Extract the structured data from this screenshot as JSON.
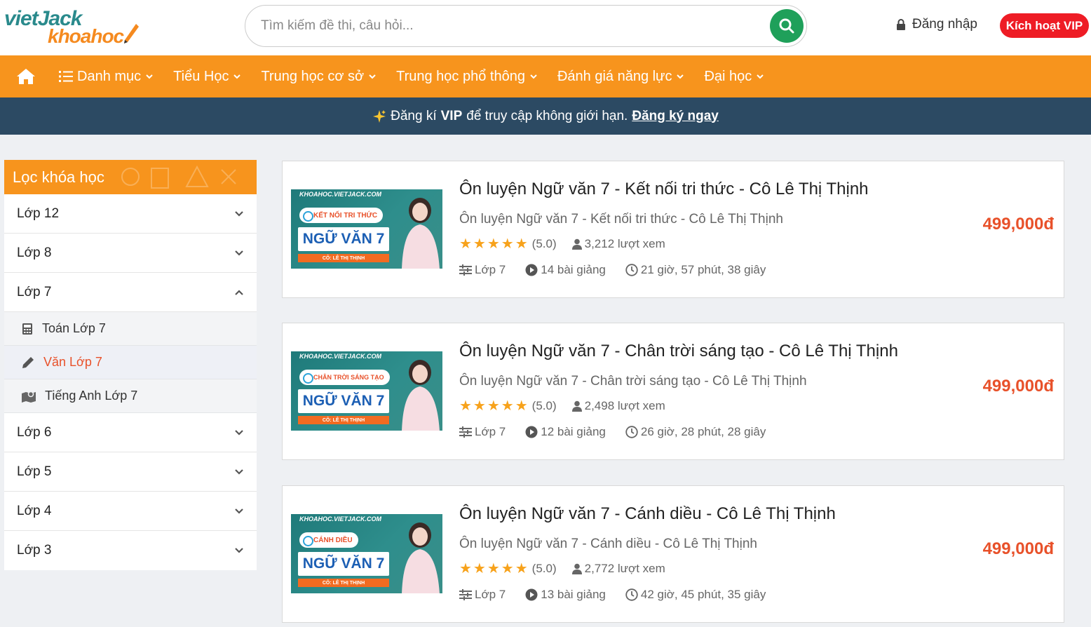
{
  "header": {
    "logo_top": "vietJack",
    "logo_bottom": "khoahoc",
    "search_placeholder": "Tìm kiếm đề thi, câu hỏi...",
    "login_label": "Đăng nhập",
    "vip_button": "Kích hoạt VIP"
  },
  "nav": {
    "items": [
      "Danh mục",
      "Tiểu Học",
      "Trung học cơ sở",
      "Trung học phổ thông",
      "Đánh giá năng lực",
      "Đại học"
    ]
  },
  "announce": {
    "prefix": "Đăng kí",
    "vip": "VIP",
    "suffix": "để truy cập không giới hạn.",
    "link": "Đăng ký ngay"
  },
  "sidebar": {
    "title": "Lọc khóa học",
    "rows": [
      "Lớp 12",
      "Lớp 8",
      "Lớp 7",
      "Lớp 6",
      "Lớp 5",
      "Lớp 4",
      "Lớp 3"
    ],
    "subitems": [
      "Toán Lớp 7",
      "Văn Lớp 7",
      "Tiếng Anh Lớp 7"
    ]
  },
  "courses": [
    {
      "title": "Ôn luyện Ngữ văn 7 - Kết nối tri thức - Cô Lê Thị Thịnh",
      "subtitle": "Ôn luyện Ngữ văn 7 - Kết nối tri thức - Cô Lê Thị Thịnh",
      "rating": "(5.0)",
      "views": "3,212 lượt xem",
      "grade": "Lớp 7",
      "lessons": "14 bài giảng",
      "duration": "21 giờ, 57 phút, 38 giây",
      "price": "499,000đ",
      "thumb_badge": "KẾT NỐI TRI THỨC"
    },
    {
      "title": "Ôn luyện Ngữ văn 7 - Chân trời sáng tạo - Cô Lê Thị Thịnh",
      "subtitle": "Ôn luyện Ngữ văn 7 - Chân trời sáng tạo - Cô Lê Thị Thịnh",
      "rating": "(5.0)",
      "views": "2,498 lượt xem",
      "grade": "Lớp 7",
      "lessons": "12 bài giảng",
      "duration": "26 giờ, 28 phút, 28 giây",
      "price": "499,000đ",
      "thumb_badge": "CHÂN TRỜI SÁNG TẠO"
    },
    {
      "title": "Ôn luyện Ngữ văn 7 - Cánh diều - Cô Lê Thị Thịnh",
      "subtitle": "Ôn luyện Ngữ văn 7 - Cánh diều - Cô Lê Thị Thịnh",
      "rating": "(5.0)",
      "views": "2,772 lượt xem",
      "grade": "Lớp 7",
      "lessons": "13 bài giảng",
      "duration": "42 giờ, 45 phút, 35 giây",
      "price": "499,000đ",
      "thumb_badge": "CÁNH DIỀU"
    }
  ],
  "thumb": {
    "site": "KHOAHOC.VIETJACK.COM",
    "subject": "NGỮ VĂN 7",
    "teacher": "CÔ: LÊ THỊ THỊNH"
  },
  "colors": {
    "orange": "#f7941d",
    "navy": "#2c4a63",
    "price": "#e8512a",
    "search_btn": "#1fa05a",
    "vip_btn": "#ee1c25"
  }
}
